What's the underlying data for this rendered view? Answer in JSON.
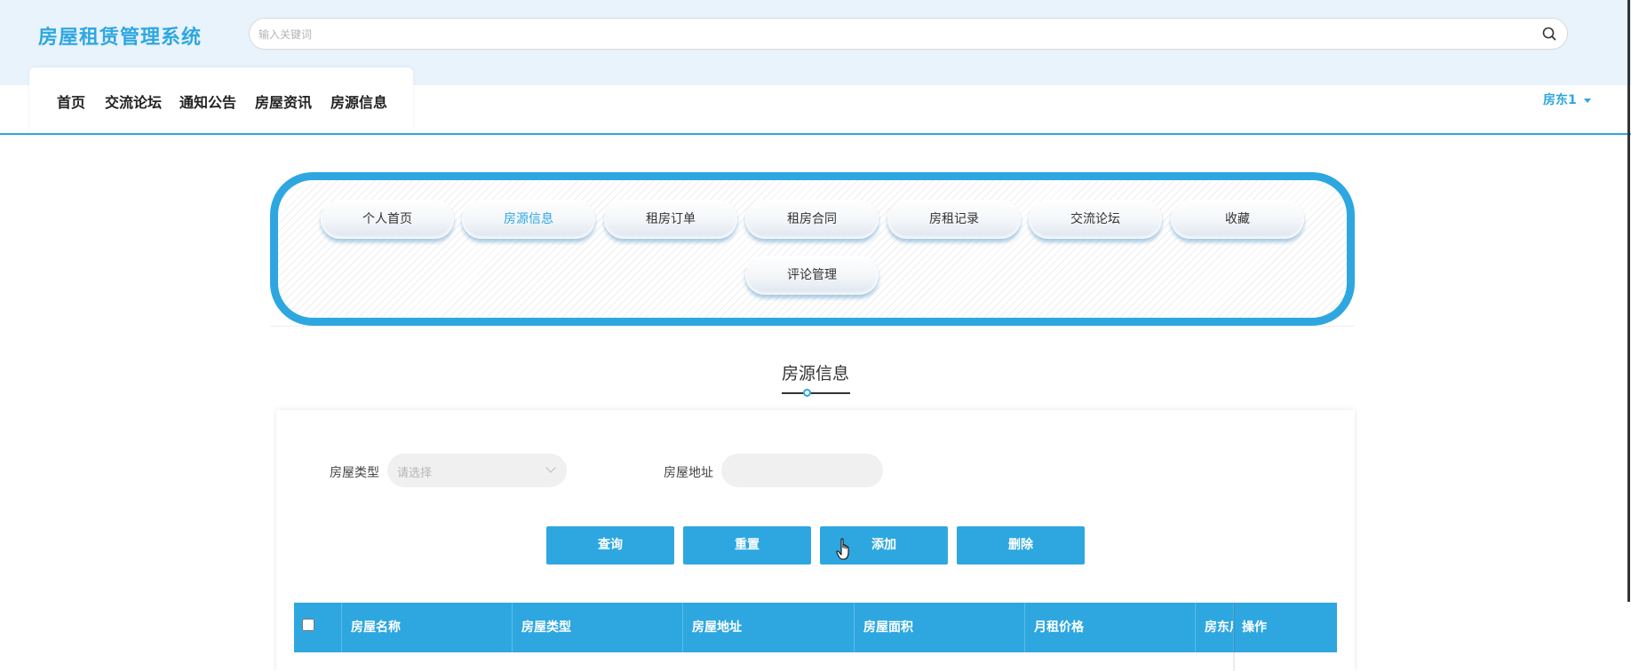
{
  "header": {
    "app_title": "房屋租赁管理系统",
    "search_placeholder": "输入关键词",
    "search_value": "",
    "nav": [
      "首页",
      "交流论坛",
      "通知公告",
      "房屋资讯",
      "房源信息"
    ],
    "user": "房东1"
  },
  "colors": {
    "accent": "#2ea7e0",
    "header_band": "#e8f3fc",
    "pill_shadow": "#64a0cd"
  },
  "icons": {
    "search": "search-icon",
    "caret": "caret-down-icon",
    "chevron": "chevron-down-icon",
    "cursor": "hand-pointer-icon"
  },
  "menu": {
    "items": [
      "个人首页",
      "房源信息",
      "租房订单",
      "租房合同",
      "房租记录",
      "交流论坛",
      "收藏",
      "评论管理"
    ],
    "active": "房源信息"
  },
  "section_title": "房源信息",
  "filters": {
    "type_label": "房屋类型",
    "type_placeholder": "请选择",
    "address_label": "房屋地址",
    "address_value": ""
  },
  "buttons": {
    "query": "查询",
    "reset": "重置",
    "add": "添加",
    "delete": "删除"
  },
  "table": {
    "columns": [
      "房屋名称",
      "房屋类型",
      "房屋地址",
      "房屋面积",
      "月租价格",
      "房东用户名",
      "操作"
    ],
    "rows": []
  }
}
